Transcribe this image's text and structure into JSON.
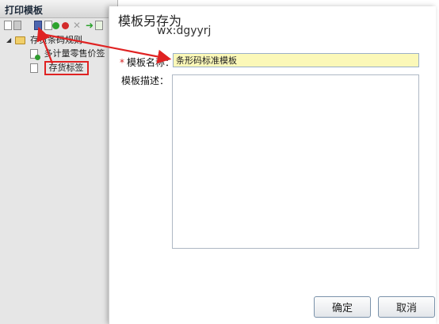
{
  "panel": {
    "title": "打印模板"
  },
  "tree": {
    "root_label": "存货条码规则",
    "child1_label": "多计量零售价签",
    "child2_label": "存货标签"
  },
  "dialog": {
    "title": "模板另存为",
    "watermark": "wx:dgyyrj",
    "required_mark": "*",
    "name_label": "模板名称：",
    "name_value": "条形码标准模板",
    "desc_label": "模板描述：",
    "desc_value": "",
    "ok_label": "确定",
    "cancel_label": "取消"
  },
  "colors": {
    "annotation": "#e02222",
    "input_highlight": "#fbf8b8",
    "required": "#d21f1f"
  },
  "icons": [
    "new-file-icon",
    "save-icon",
    "save-as-icon",
    "copy-icon",
    "confirm-icon",
    "delete-icon",
    "cut-icon",
    "move-up-icon",
    "move-down-icon",
    "folder-icon",
    "document-icon"
  ]
}
